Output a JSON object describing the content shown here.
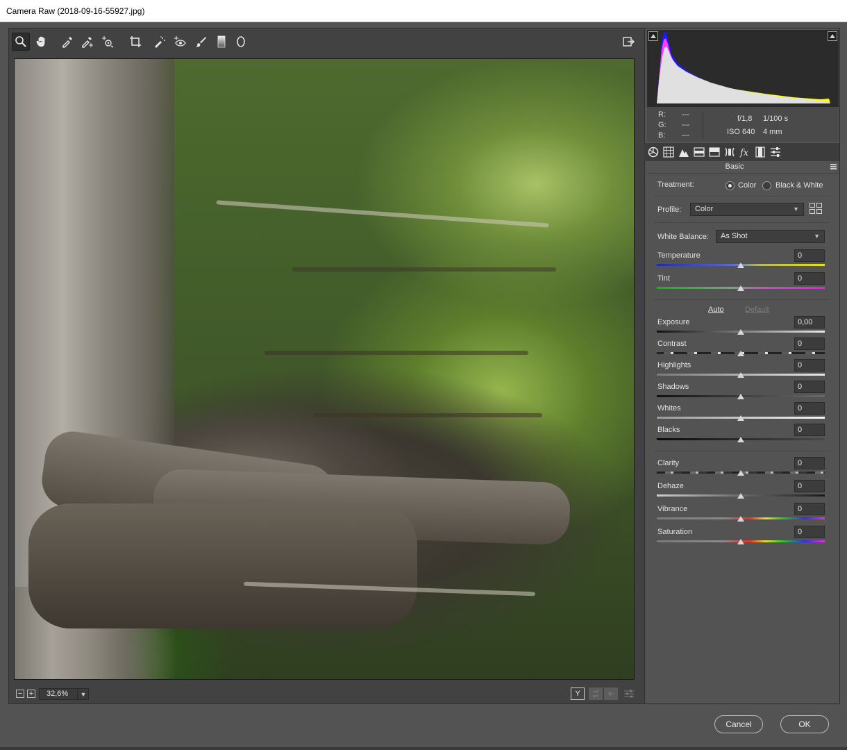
{
  "window": {
    "title": "Camera Raw (2018-09-16-55927.jpg)"
  },
  "toolbar": {
    "tools": [
      "zoom-icon",
      "hand-icon",
      "white-balance-icon",
      "color-sampler-icon",
      "targeted-adjustment-icon",
      "crop-icon",
      "spot-removal-icon",
      "red-eye-icon",
      "adjustment-brush-icon",
      "graduated-filter-icon",
      "radial-filter-icon"
    ],
    "open_preferences_icon": "export-icon"
  },
  "zoom": {
    "value": "32,6%",
    "minus": "−",
    "plus": "+"
  },
  "preview_controls": {
    "before_after": "Y"
  },
  "histogram": {
    "colors": {
      "blue": "#1a1aff",
      "magenta": "#ff3cff",
      "yellow": "#ffff00",
      "white": "#e0e0e0"
    }
  },
  "readout": {
    "r_label": "R:",
    "g_label": "G:",
    "b_label": "B:",
    "r_value": "---",
    "g_value": "---",
    "b_value": "---",
    "aperture": "f/1,8",
    "shutter": "1/100 s",
    "iso": "ISO 640",
    "focal": "4 mm"
  },
  "panel": {
    "title": "Basic",
    "treatment_label": "Treatment:",
    "treatment_color": "Color",
    "treatment_bw": "Black & White",
    "profile_label": "Profile:",
    "profile_value": "Color",
    "wb_label": "White Balance:",
    "wb_value": "As Shot",
    "auto_label": "Auto",
    "default_label": "Default",
    "sliders": {
      "temperature": {
        "label": "Temperature",
        "value": "0"
      },
      "tint": {
        "label": "Tint",
        "value": "0"
      },
      "exposure": {
        "label": "Exposure",
        "value": "0,00"
      },
      "contrast": {
        "label": "Contrast",
        "value": "0"
      },
      "highlights": {
        "label": "Highlights",
        "value": "0"
      },
      "shadows": {
        "label": "Shadows",
        "value": "0"
      },
      "whites": {
        "label": "Whites",
        "value": "0"
      },
      "blacks": {
        "label": "Blacks",
        "value": "0"
      },
      "clarity": {
        "label": "Clarity",
        "value": "0"
      },
      "dehaze": {
        "label": "Dehaze",
        "value": "0"
      },
      "vibrance": {
        "label": "Vibrance",
        "value": "0"
      },
      "saturation": {
        "label": "Saturation",
        "value": "0"
      }
    }
  },
  "buttons": {
    "cancel": "Cancel",
    "ok": "OK"
  }
}
